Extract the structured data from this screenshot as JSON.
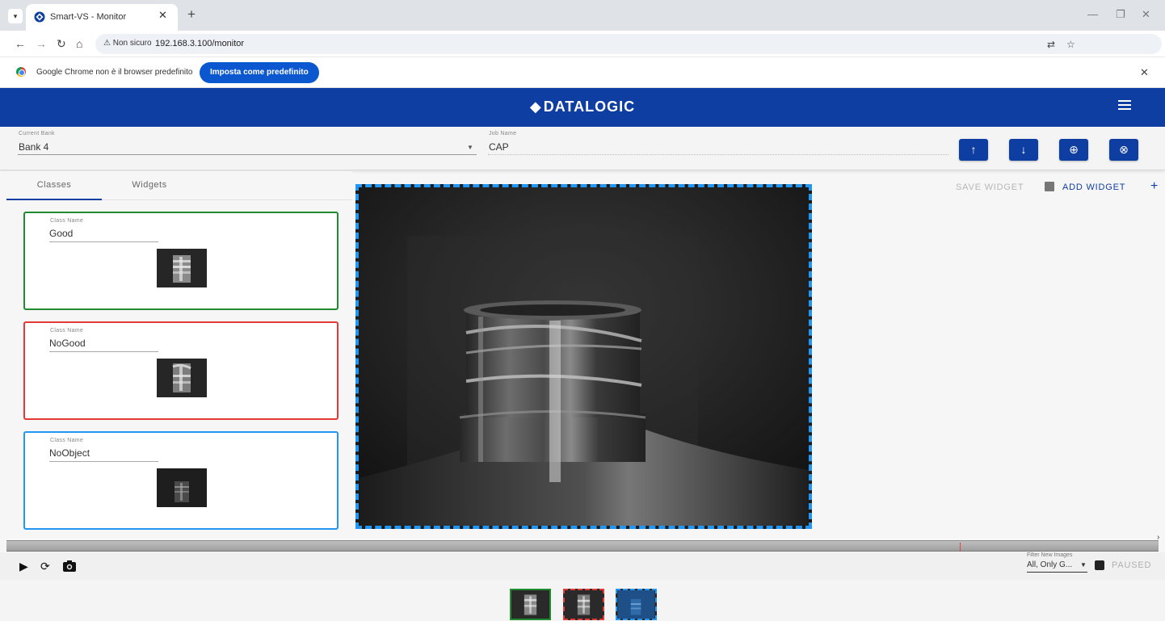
{
  "browser": {
    "tab_title": "Smart-VS - Monitor",
    "security_label": "Non sicuro",
    "url": "192.168.3.100/monitor",
    "infobar_text": "Google Chrome non è il browser predefinito",
    "infobar_button": "Imposta come predefinito"
  },
  "app": {
    "brand": "DATALOGIC",
    "brand_mark": "◆"
  },
  "toolbar": {
    "bank_label": "Current Bank",
    "bank_value": "Bank 4",
    "job_label": "Job Name",
    "job_value": "CAP",
    "buttons": [
      "↑",
      "↓",
      "⊕",
      "⊗"
    ]
  },
  "left": {
    "tabs": [
      "Classes",
      "Widgets"
    ],
    "active_tab": "Classes",
    "classes": [
      {
        "label": "Class Name",
        "name": "Good",
        "color": "#1f8a2e"
      },
      {
        "label": "Class Name",
        "name": "NoGood",
        "color": "#e53935"
      },
      {
        "label": "Class Name",
        "name": "NoObject",
        "color": "#2196f3"
      }
    ]
  },
  "right": {
    "save_widget": "SAVE WIDGET",
    "add_widget": "ADD WIDGET"
  },
  "controls": {
    "filter_label": "Filter New Images",
    "filter_value": "All, Only G...",
    "status": "PAUSED"
  },
  "colors": {
    "accent": "#0f3ea2",
    "good": "#1f8a2e",
    "nogood": "#e53935",
    "noobject": "#2196f3"
  }
}
